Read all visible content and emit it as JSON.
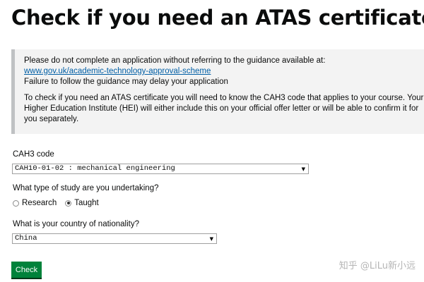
{
  "page": {
    "title": "Check if you need an ATAS certificate"
  },
  "notice": {
    "line1": "Please do not complete an application without referring to the guidance available at:",
    "link": "www.gov.uk/academic-technology-approval-scheme",
    "line2": "Failure to follow the guidance may delay your application",
    "paragraph": "To check if you need an ATAS certificate you will need to know the CAH3 code that applies to your course. Your Higher Education Institute (HEI) will either include this on your official offer letter or will be able to confirm it for you separately."
  },
  "cah3": {
    "label": "CAH3 code",
    "selected": "CAH10-01-02 : mechanical engineering"
  },
  "study_type": {
    "label": "What type of study are you undertaking?",
    "options": [
      {
        "label": "Research",
        "checked": false
      },
      {
        "label": "Taught",
        "checked": true
      }
    ]
  },
  "nationality": {
    "label": "What is your country of nationality?",
    "selected": "China"
  },
  "actions": {
    "check_label": "Check"
  },
  "watermark": {
    "text": "知乎 @LiLu新小远"
  }
}
